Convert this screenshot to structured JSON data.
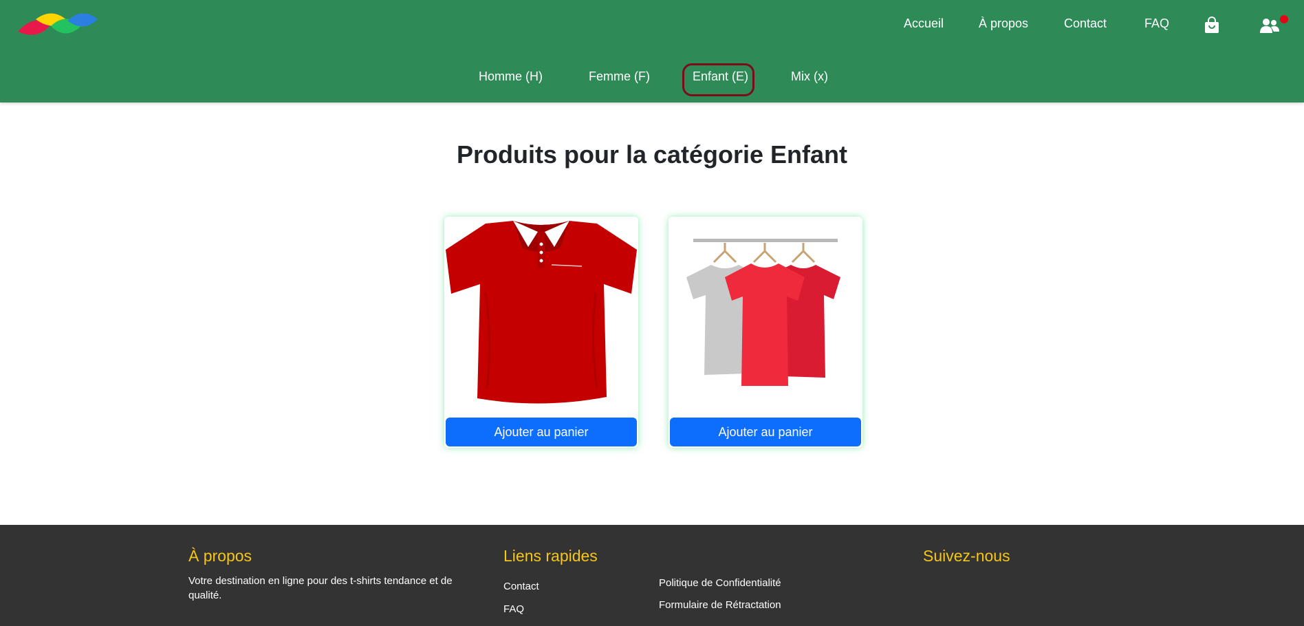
{
  "brand": {
    "logo_icon": "leaf-logo-icon"
  },
  "topnav": {
    "items": [
      {
        "label": "Accueil"
      },
      {
        "label": "À propos"
      },
      {
        "label": "Contact"
      },
      {
        "label": "FAQ"
      }
    ],
    "cart_icon": "shopping-bag-icon",
    "user_icon": "users-icon",
    "notification_color": "#e30613"
  },
  "categories": {
    "items": [
      {
        "label": "Homme (H)"
      },
      {
        "label": "Femme (F)"
      },
      {
        "label": "Enfant (E)",
        "active": true
      },
      {
        "label": "Mix (x)"
      }
    ]
  },
  "main": {
    "title": "Produits pour la catégorie Enfant",
    "products": [
      {
        "image": "red-polo-shirt",
        "button_label": "Ajouter au panier"
      },
      {
        "image": "tshirts-on-hangers",
        "button_label": "Ajouter au panier"
      }
    ]
  },
  "footer": {
    "about": {
      "heading": "À propos",
      "text": "Votre destination en ligne pour des t-shirts tendance et de qualité."
    },
    "links": {
      "heading": "Liens rapides",
      "col1": [
        "Contact",
        "FAQ"
      ],
      "col2": [
        "Politique de Confidentialité",
        "Formulaire de Rétractation"
      ]
    },
    "social": {
      "heading": "Suivez-nous"
    }
  },
  "colors": {
    "header_bg": "#2e8b57",
    "button_blue": "#0d6efd",
    "footer_bg": "#333333",
    "footer_heading": "#f5c518",
    "active_outline": "#7a0d1a"
  }
}
